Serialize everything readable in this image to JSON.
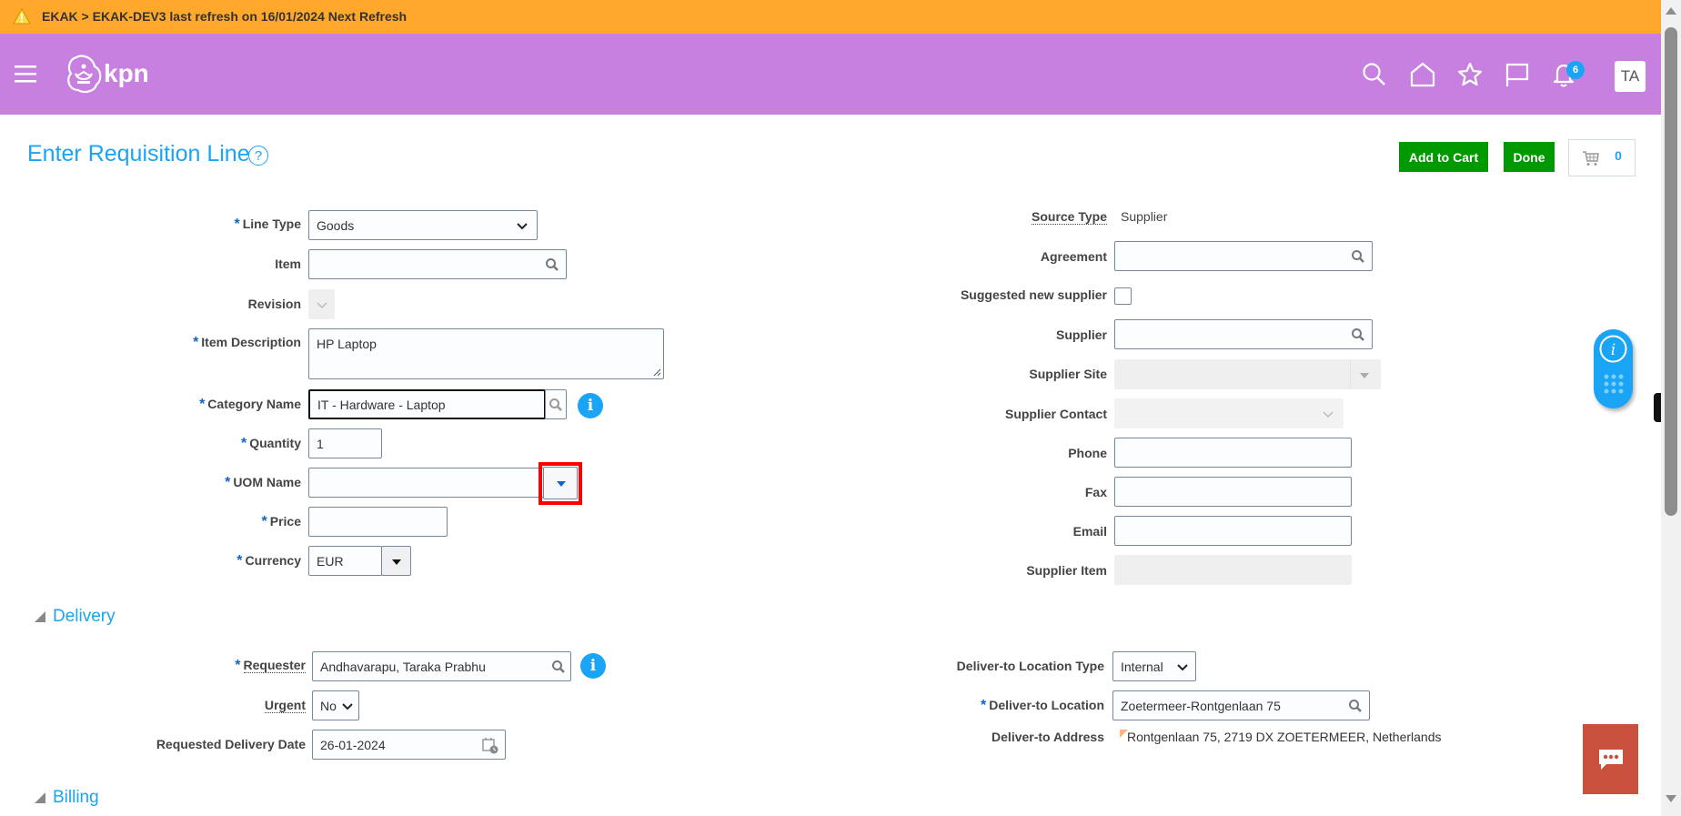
{
  "banner": {
    "text": "EKAK > EKAK-DEV3 last refresh on 16/01/2024 Next Refresh",
    "color": "#ffa82b"
  },
  "header": {
    "brand": "kpn",
    "color": "#c880e0",
    "icons": [
      "menu-icon",
      "search-icon",
      "home-icon",
      "star-icon",
      "flag-icon",
      "bell-icon"
    ],
    "notification_count": "6",
    "avatar_initials": "TA"
  },
  "page": {
    "title": "Enter Requisition Line",
    "help_label": "?",
    "add_to_cart_label": "Add to Cart",
    "done_label": "Done",
    "cart_count": "0",
    "accent_color": "#1aa4f5",
    "button_color": "#009900"
  },
  "left_form": {
    "line_type": {
      "label": "Line Type",
      "value": "Goods",
      "required": true
    },
    "item": {
      "label": "Item",
      "value": ""
    },
    "revision": {
      "label": "Revision",
      "value": ""
    },
    "item_description": {
      "label": "Item Description",
      "value": "HP Laptop",
      "required": true
    },
    "category_name": {
      "label": "Category Name",
      "value": "IT - Hardware - Laptop",
      "required": true
    },
    "quantity": {
      "label": "Quantity",
      "value": "1",
      "required": true
    },
    "uom_name": {
      "label": "UOM Name",
      "value": "",
      "required": true
    },
    "price": {
      "label": "Price",
      "value": "",
      "required": true
    },
    "currency": {
      "label": "Currency",
      "value": "EUR",
      "required": true
    }
  },
  "right_form": {
    "source_type": {
      "label": "Source Type",
      "value": "Supplier"
    },
    "agreement": {
      "label": "Agreement",
      "value": ""
    },
    "suggested_new_supplier": {
      "label": "Suggested new supplier",
      "checked": false
    },
    "supplier": {
      "label": "Supplier",
      "value": ""
    },
    "supplier_site": {
      "label": "Supplier Site",
      "value": ""
    },
    "supplier_contact": {
      "label": "Supplier Contact",
      "value": ""
    },
    "phone": {
      "label": "Phone",
      "value": ""
    },
    "fax": {
      "label": "Fax",
      "value": ""
    },
    "email": {
      "label": "Email",
      "value": ""
    },
    "supplier_item": {
      "label": "Supplier Item",
      "value": ""
    }
  },
  "delivery": {
    "section_label": "Delivery",
    "requester": {
      "label": "Requester",
      "value": "Andhavarapu, Taraka Prabhu",
      "required": true
    },
    "urgent": {
      "label": "Urgent",
      "value": "No"
    },
    "requested_delivery_date": {
      "label": "Requested Delivery Date",
      "value": "26-01-2024"
    },
    "deliver_to_location_type": {
      "label": "Deliver-to Location Type",
      "value": "Internal"
    },
    "deliver_to_location": {
      "label": "Deliver-to Location",
      "value": "Zoetermeer-Rontgenlaan 75",
      "required": true
    },
    "deliver_to_address": {
      "label": "Deliver-to Address",
      "value": "Rontgenlaan 75, 2719 DX ZOETERMEER, Netherlands"
    }
  },
  "billing": {
    "section_label": "Billing"
  },
  "required_marker": "*",
  "chat_color": "#c8503c"
}
